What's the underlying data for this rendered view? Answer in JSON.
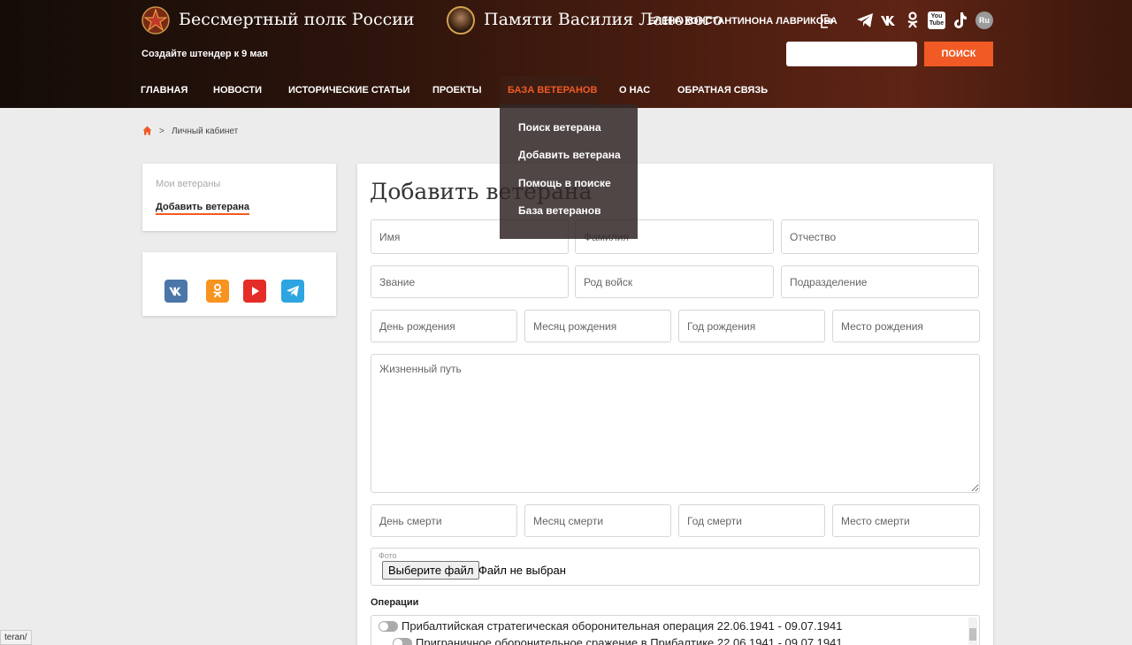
{
  "header": {
    "site_title": "Бессмертный полк России",
    "memory_title": "Памяти Василия Ланового",
    "user_name": "ЕЛЕНА КОНСТАНТИНОНА ЛАВРИКОВА",
    "promo": "Создайте штендер к 9 мая",
    "search_button": "ПОИСК",
    "socials": [
      "telegram-icon",
      "vk-icon",
      "ok-icon",
      "youtube-icon",
      "tiktok-icon",
      "rutube-icon"
    ],
    "ru_label": "Ru",
    "yt_label_1": "You",
    "yt_label_2": "Tube"
  },
  "nav": {
    "items": [
      "ГЛАВНАЯ",
      "НОВОСТИ",
      "ИСТОРИЧЕСКИЕ СТАТЬИ",
      "ПРОЕКТЫ",
      "БАЗА ВЕТЕРАНОВ",
      "О НАС",
      "ОБРАТНАЯ СВЯЗЬ"
    ],
    "active": "БАЗА ВЕТЕРАНОВ"
  },
  "dropdown": {
    "items": [
      "Поиск ветерана",
      "Добавить ветерана",
      "Помощь в поиске",
      "База ветеранов"
    ]
  },
  "breadcrumb": {
    "separator": ">",
    "label": "Личный кабинет"
  },
  "sidebar": {
    "items": [
      "Мои ветераны",
      "Добавить ветерана"
    ],
    "active": "Добавить ветерана",
    "socials": [
      "vk-icon",
      "ok-icon",
      "youtube-icon",
      "telegram-icon"
    ]
  },
  "form": {
    "title": "Добавить ветерана",
    "placeholders": {
      "first_name": "Имя",
      "last_name": "Фамилия",
      "patronymic": "Отчество",
      "rank": "Звание",
      "branch": "Род войск",
      "unit": "Подразделение",
      "birth_day": "День рождения",
      "birth_month": "Месяц рождения",
      "birth_year": "Год рождения",
      "birth_place": "Место рождения",
      "biography": "Жизненный путь",
      "death_day": "День смерти",
      "death_month": "Месяц смерти",
      "death_year": "Год смерти",
      "death_place": "Место смерти"
    },
    "photo": {
      "label": "Фото",
      "button": "Выберите файл",
      "status": "Файл не выбран"
    },
    "operations": {
      "title": "Операции",
      "items": [
        "Прибалтийская стратегическая оборонительная операция 22.06.1941 - 09.07.1941",
        "Приграничное оборонительное сражение в Прибалтике 22.06.1941 - 09.07.1941"
      ]
    }
  },
  "statusbar": {
    "url": "teran/"
  },
  "colors": {
    "accent": "#f15a24",
    "header_dark": "#2a130b"
  }
}
